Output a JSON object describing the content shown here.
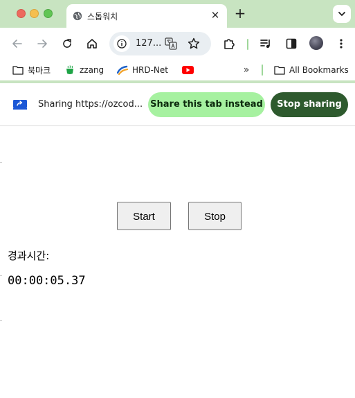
{
  "window": {
    "tab_title": "스톱워치",
    "tab_close": "✕",
    "new_tab": "+"
  },
  "toolbar": {
    "url": "127..."
  },
  "bookmarks": [
    {
      "label": "북마크"
    },
    {
      "label": "zzang"
    },
    {
      "label": "HRD-Net"
    }
  ],
  "bookmarks_more": "»",
  "all_bookmarks": "All Bookmarks",
  "sharing": {
    "message": "Sharing https://ozcod...",
    "share_this_tab_label": "Share this tab instead",
    "stop_sharing_label": "Stop sharing"
  },
  "stopwatch": {
    "start_label": "Start",
    "stop_label": "Stop",
    "elapsed_label": "경과시간:",
    "elapsed_value": "00:00:05.37"
  },
  "colors": {
    "frame": "#c8e4c1",
    "accent_light": "#a6f1a0",
    "accent_dark": "#2e5a2e"
  }
}
